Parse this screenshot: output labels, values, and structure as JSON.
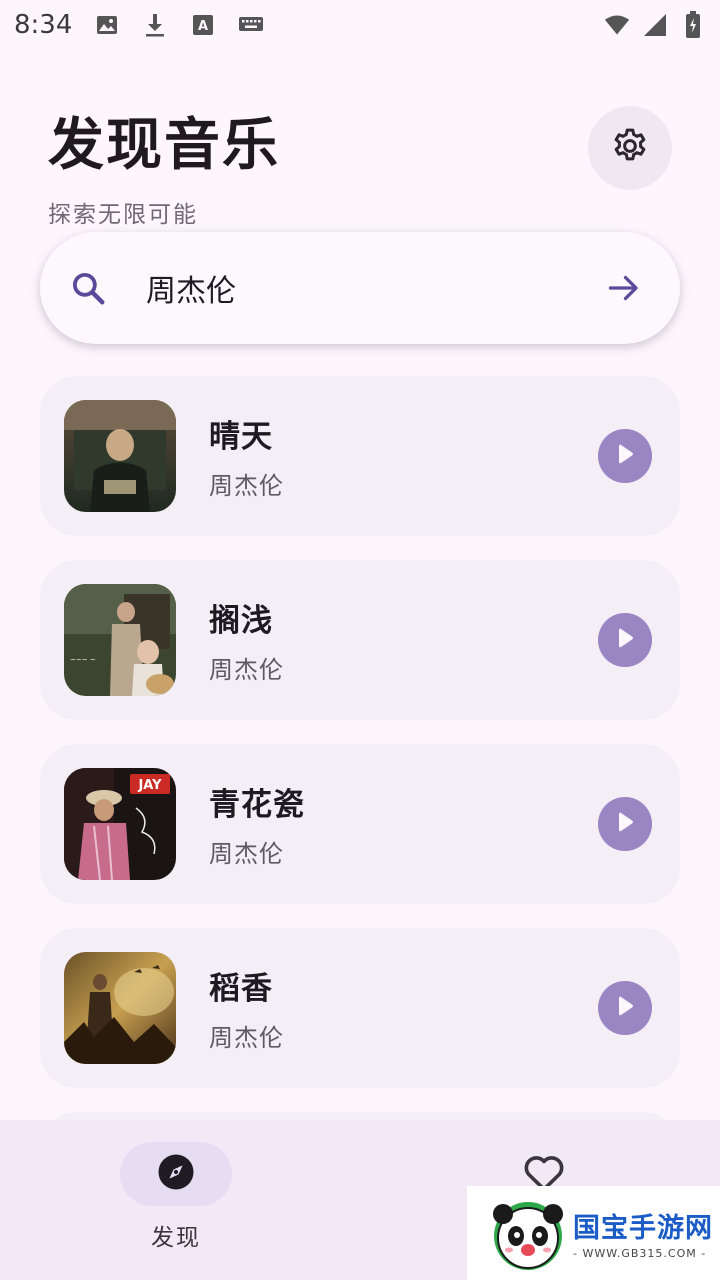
{
  "status_bar": {
    "time": "8:34",
    "left_icons": [
      "image-icon",
      "download-icon",
      "font-icon",
      "keyboard-icon"
    ],
    "right_icons": [
      "wifi-icon",
      "signal-icon",
      "battery-icon"
    ]
  },
  "header": {
    "title": "发现音乐",
    "subtitle": "探索无限可能",
    "settings_icon": "gear-icon"
  },
  "search": {
    "value": "周杰伦",
    "icon": "search-icon",
    "submit_icon": "arrow-right-icon"
  },
  "songs": [
    {
      "title": "晴天",
      "artist": "周杰伦"
    },
    {
      "title": "搁浅",
      "artist": "周杰伦"
    },
    {
      "title": "青花瓷",
      "artist": "周杰伦"
    },
    {
      "title": "稻香",
      "artist": "周杰伦"
    }
  ],
  "bottom_nav": {
    "items": [
      {
        "label": "发现",
        "icon": "compass-icon",
        "active": true
      },
      {
        "label": "",
        "icon": "heart-icon",
        "active": false
      }
    ]
  },
  "watermark": {
    "brand": "国宝手游网",
    "url": "- WWW.GB315.COM -"
  },
  "colors": {
    "background": "#fdf7fd",
    "card": "#f4eef6",
    "accent": "#9a86c2",
    "primary_icon": "#5b4a9a",
    "nav_bg": "#f1e9f5"
  }
}
